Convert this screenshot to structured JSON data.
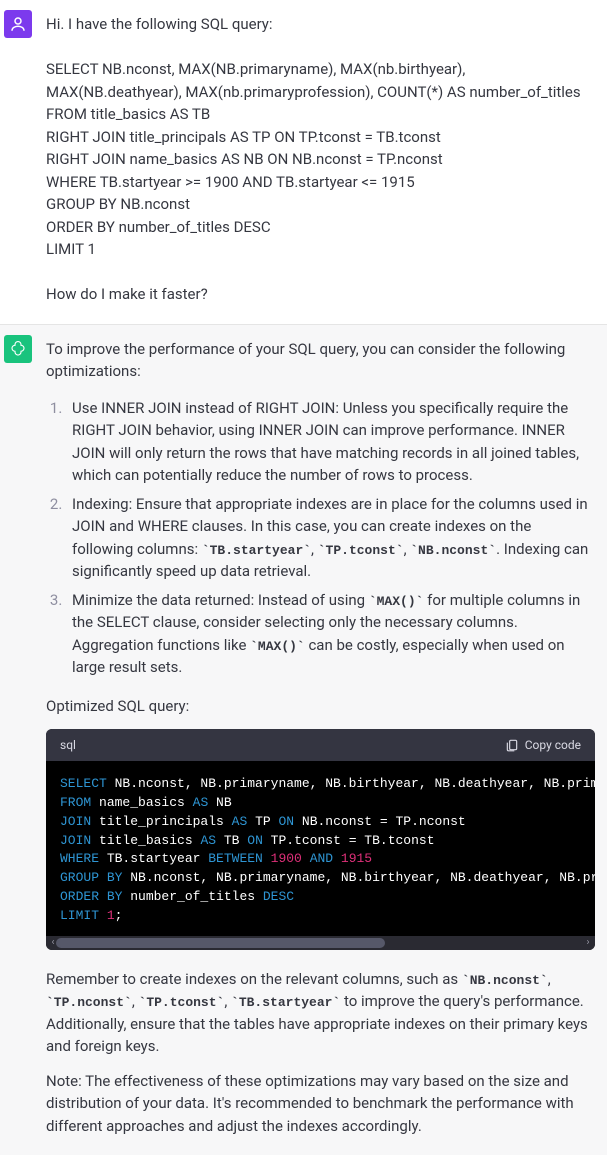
{
  "user_message": "Hi. I have the following SQL query:\n\nSELECT NB.nconst, MAX(NB.primaryname), MAX(nb.birthyear), MAX(NB.deathyear), MAX(nb.primaryprofession), COUNT(*) AS number_of_titles\nFROM title_basics AS TB\nRIGHT JOIN title_principals AS TP ON TP.tconst = TB.tconst\nRIGHT JOIN name_basics AS NB ON NB.nconst = TP.nconst\nWHERE TB.startyear >= 1900 AND TB.startyear <= 1915\nGROUP BY NB.nconst\nORDER BY number_of_titles DESC\nLIMIT 1\n\nHow do I make it faster?",
  "assistant": {
    "intro": "To improve the performance of your SQL query, you can consider the following optimizations:",
    "list": {
      "item1_text": "Use INNER JOIN instead of RIGHT JOIN: Unless you specifically require the RIGHT JOIN behavior, using INNER JOIN can improve performance. INNER JOIN will only return the rows that have matching records in all joined tables, which can potentially reduce the number of rows to process.",
      "item2_pre": "Indexing: Ensure that appropriate indexes are in place for the columns used in JOIN and WHERE clauses. In this case, you can create indexes on the following columns: ",
      "item2_c1": "`TB.startyear`",
      "item2_s1": ", ",
      "item2_c2": "`TP.tconst`",
      "item2_s2": ", ",
      "item2_c3": "`NB.nconst`",
      "item2_post": ". Indexing can significantly speed up data retrieval.",
      "item3_pre": "Minimize the data returned: Instead of using ",
      "item3_c1": "`MAX()`",
      "item3_mid": " for multiple columns in the SELECT clause, consider selecting only the necessary columns. Aggregation functions like ",
      "item3_c2": "`MAX()`",
      "item3_post": " can be costly, especially when used on large result sets."
    },
    "optimized_label": "Optimized SQL query:",
    "code": {
      "lang": "sql",
      "copy_label": "Copy code",
      "lines": {
        "l1_select": "SELECT",
        "l1_rest": " NB.nconst, NB.primaryname, NB.birthyear, NB.deathyear, NB.primaryprofession, COUNT(*) AS number_of_titles",
        "l2_from": "FROM",
        "l2_nb": " name_basics ",
        "l2_as": "AS",
        "l2_alias": " NB",
        "l3_join": "JOIN",
        "l3_mid": " title_principals ",
        "l3_as": "AS",
        "l3_alias": " TP ",
        "l3_on": "ON",
        "l3_cond": " NB.nconst = TP.nconst",
        "l4_join": "JOIN",
        "l4_mid": " title_basics ",
        "l4_as": "AS",
        "l4_alias": " TB ",
        "l4_on": "ON",
        "l4_cond": " TP.tconst = TB.tconst",
        "l5_where": "WHERE",
        "l5_col": " TB.startyear ",
        "l5_between": "BETWEEN",
        "l5_sp1": " ",
        "l5_n1": "1900",
        "l5_sp2": " ",
        "l5_and": "AND",
        "l5_sp3": " ",
        "l5_n2": "1915",
        "l6_group": "GROUP",
        "l6_by": " BY",
        "l6_cols": " NB.nconst, NB.primaryname, NB.birthyear, NB.deathyear, NB.primaryprofession",
        "l7_order": "ORDER",
        "l7_by": " BY",
        "l7_col": " number_of_titles ",
        "l7_desc": "DESC",
        "l8_limit": "LIMIT",
        "l8_sp": " ",
        "l8_n": "1",
        "l8_semi": ";"
      }
    },
    "outro1_pre": "Remember to create indexes on the relevant columns, such as ",
    "outro1_c1": "`NB.nconst`",
    "outro1_s1": ", ",
    "outro1_c2": "`TP.nconst`",
    "outro1_s2": ", ",
    "outro1_c3": "`TP.tconst`",
    "outro1_s3": ", ",
    "outro1_c4": "`TB.startyear`",
    "outro1_post": " to improve the query's performance. Additionally, ensure that the tables have appropriate indexes on their primary keys and foreign keys.",
    "outro2": "Note: The effectiveness of these optimizations may vary based on the size and distribution of your data. It's recommended to benchmark the performance with different approaches and adjust the indexes accordingly."
  }
}
